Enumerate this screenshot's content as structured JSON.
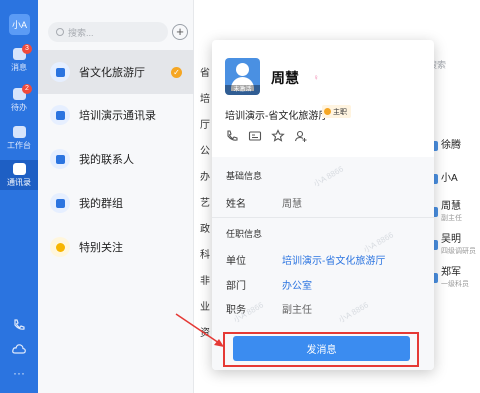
{
  "rail": {
    "avatar": "小A",
    "items": [
      {
        "label": "消息",
        "badge": "3"
      },
      {
        "label": "待办",
        "badge": "2"
      },
      {
        "label": "工作台",
        "badge": ""
      },
      {
        "label": "通讯录",
        "badge": ""
      }
    ]
  },
  "panel": {
    "search_placeholder": "搜索...",
    "add": "+",
    "items": [
      {
        "label": "省文化旅游厅"
      },
      {
        "label": "培训演示通讯录"
      },
      {
        "label": "我的联系人"
      },
      {
        "label": "我的群组"
      },
      {
        "label": "特别关注"
      }
    ]
  },
  "background": {
    "strip": [
      "省",
      "培",
      "厅",
      "公",
      "办",
      "艺",
      "政",
      "科",
      "非",
      "业",
      "资"
    ],
    "search": "搜索",
    "people": [
      {
        "name": "徐腾",
        "title": ""
      },
      {
        "name": "小A",
        "title": ""
      },
      {
        "name": "周慧",
        "title": "副主任"
      },
      {
        "name": "吴明",
        "title": "四级调研员"
      },
      {
        "name": "郑军",
        "title": "一级科员"
      }
    ]
  },
  "profile": {
    "avatar_tag": "未激活",
    "name": "周慧",
    "gender_symbol": "♀",
    "org": "培训演示-省文化旅游厅",
    "main_badge": "主职",
    "basic_title": "基础信息",
    "name_label": "姓名",
    "name_value": "周慧",
    "job_title": "任职信息",
    "unit_label": "单位",
    "unit_value": "培训演示-省文化旅游厅",
    "dept_label": "部门",
    "dept_value": "办公室",
    "post_label": "职务",
    "post_value": "副主任",
    "send_button": "发消息",
    "watermark": "小A 8866"
  },
  "colors": {
    "accent": "#2b74e0",
    "button": "#3b8cf0",
    "highlight": "#e53935",
    "verified": "#f5a623"
  }
}
